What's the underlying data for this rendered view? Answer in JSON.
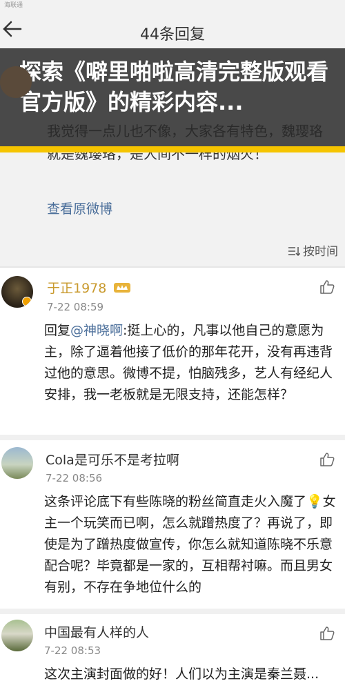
{
  "status": {
    "carrier": "海联通"
  },
  "nav": {
    "title": "44条回复"
  },
  "banner": {
    "text": "探索《噼里啪啦高清完整版观看官方版》的精彩内容..."
  },
  "original": {
    "text": "我觉得一点儿也不像，大家各有特色，魏璎珞就是魏璎珞，是人间不一样的烟火！",
    "view_link": "查看原微博",
    "sort_label": "按时间"
  },
  "comments": [
    {
      "user": "于正1978",
      "time": "7-22 08:59",
      "reply_prefix": "回复",
      "mention": "@神晓啊",
      "text": ":挺上心的，凡事以他自己的意愿为主，除了逼着他接了低价的那年花开，没有再违背过他的意思。微博不提，怕脑残多，艺人有经纪人安排，我一老板就是无限支持，还能怎样？"
    },
    {
      "user": "Cola是可乐不是考拉啊",
      "time": "7-22 08:56",
      "text": "这条评论底下有些陈晓的粉丝简直走火入魔了💡女主一个玩笑而已啊，怎么就蹭热度了？再说了，即使是为了蹭热度做宣传，你怎么就知道陈晓不乐意配合呢？毕竟都是一家的，互相帮衬嘛。而且男女有别，不存在争地位什么的"
    },
    {
      "user": "中国最有人样的人",
      "time": "7-22 08:53",
      "text": "这次主演封面做的好！人们以为主演是秦兰聂..."
    }
  ],
  "colors": {
    "banner_bar": "#f5c400",
    "link": "#4a6e9a",
    "vip_name": "#c99a2e"
  }
}
